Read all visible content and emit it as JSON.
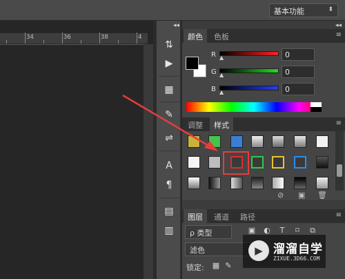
{
  "workspace": {
    "label": "基本功能",
    "arrow": "⬍"
  },
  "ruler": {
    "labels": [
      "34",
      "36",
      "38",
      "4"
    ]
  },
  "strip": {
    "collapse": "◂◂",
    "icons": [
      "history-icon",
      "play-icon",
      "cube-icon",
      "brush-icon",
      "adjust-icon",
      "type-icon",
      "paragraph-icon",
      "layers-icon",
      "notes-icon"
    ],
    "glyphs": [
      "⇅",
      "▶",
      "▦",
      "✎",
      "⇌",
      "A",
      "¶",
      "▤",
      "▥"
    ]
  },
  "panel_top": {
    "collapse": "◂◂",
    "close": "✕"
  },
  "color_panel": {
    "tabs": [
      "颜色",
      "色板"
    ],
    "channels": [
      {
        "label": "R",
        "value": "0",
        "color": "#e02020"
      },
      {
        "label": "G",
        "value": "0",
        "color": "#20d020"
      },
      {
        "label": "B",
        "value": "0",
        "color": "#2040e0"
      }
    ],
    "menu": "≡"
  },
  "styles_panel": {
    "tabs": [
      "调整",
      "样式"
    ],
    "menu": "≡",
    "footer": {
      "clear": "⊘",
      "new": "▣",
      "delete": "🗑"
    }
  },
  "layers_panel": {
    "tabs": [
      "图层",
      "通道",
      "路径"
    ],
    "menu": "≡",
    "filter_label": "ρ 类型",
    "blend_mode": "滤色",
    "lock_label": "锁定:"
  },
  "watermark": {
    "text": "溜溜自学",
    "sub": "ZIXUE.3D66.COM",
    "logo": "▶"
  },
  "colors": {
    "highlight": "#e53d3d",
    "arrow": "#e53d3d"
  }
}
